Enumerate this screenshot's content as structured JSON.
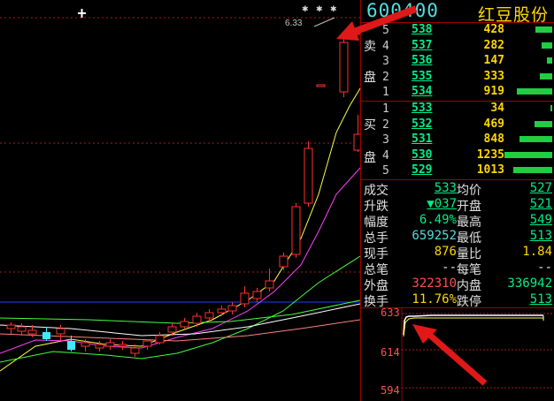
{
  "stock": {
    "code": "600400",
    "name": "红豆股份"
  },
  "chart": {
    "high_label": "6.33",
    "markers": [
      "✱",
      "✱",
      "✱"
    ],
    "colors": {
      "up": "#ff3030",
      "down": "#40e8ff",
      "ma5": "#ffffff",
      "ma10": "#ffff40",
      "ma20": "#ff40ff",
      "ma30": "#40ff40",
      "ma60": "#ff8080",
      "base": "#2040ff"
    }
  },
  "orderbook": {
    "sell_label": [
      "卖",
      "盘"
    ],
    "buy_label": [
      "买",
      "盘"
    ],
    "sell": [
      {
        "level": "5",
        "price": "538",
        "volume": "428",
        "bar": 0.16
      },
      {
        "level": "4",
        "price": "537",
        "volume": "282",
        "bar": 0.1
      },
      {
        "level": "3",
        "price": "536",
        "volume": "147",
        "bar": 0.05
      },
      {
        "level": "2",
        "price": "535",
        "volume": "333",
        "bar": 0.12
      },
      {
        "level": "1",
        "price": "534",
        "volume": "919",
        "bar": 0.33
      }
    ],
    "buy": [
      {
        "level": "1",
        "price": "533",
        "volume": "34",
        "bar": 0.02
      },
      {
        "level": "2",
        "price": "532",
        "volume": "469",
        "bar": 0.17
      },
      {
        "level": "3",
        "price": "531",
        "volume": "848",
        "bar": 0.31
      },
      {
        "level": "4",
        "price": "530",
        "volume": "1235",
        "bar": 0.45
      },
      {
        "level": "5",
        "price": "529",
        "volume": "1013",
        "bar": 0.37
      }
    ]
  },
  "stats": [
    {
      "l1": "成交",
      "v1": "533",
      "c1": "c-green ul",
      "l2": "均价",
      "v2": "527",
      "c2": "c-green ul"
    },
    {
      "l1": "升跌",
      "v1": "▼037",
      "c1": "c-green ul",
      "l2": "开盘",
      "v2": "521",
      "c2": "c-green ul"
    },
    {
      "l1": "幅度",
      "v1": "6.49%",
      "c1": "c-green",
      "l2": "最高",
      "v2": "549",
      "c2": "c-green ul"
    },
    {
      "l1": "总手",
      "v1": "659252",
      "c1": "c-cyan",
      "l2": "最低",
      "v2": "513",
      "c2": "c-green ul"
    },
    {
      "l1": "现手",
      "v1": "876",
      "c1": "c-yellow",
      "l2": "量比",
      "v2": "1.84",
      "c2": "c-yellow"
    },
    {
      "l1": "总笔",
      "v1": "--",
      "c1": "c-white",
      "l2": "每笔",
      "v2": "--",
      "c2": "c-white"
    },
    {
      "l1": "外盘",
      "v1": "322310",
      "c1": "c-red",
      "l2": "内盘",
      "v2": "336942",
      "c2": "c-green"
    },
    {
      "l1": "换手",
      "v1": "11.76%",
      "c1": "c-yellow",
      "l2": "跌停",
      "v2": "513",
      "c2": "c-green ul"
    }
  ],
  "mini": {
    "ticks": [
      "633",
      "614",
      "594"
    ]
  }
}
